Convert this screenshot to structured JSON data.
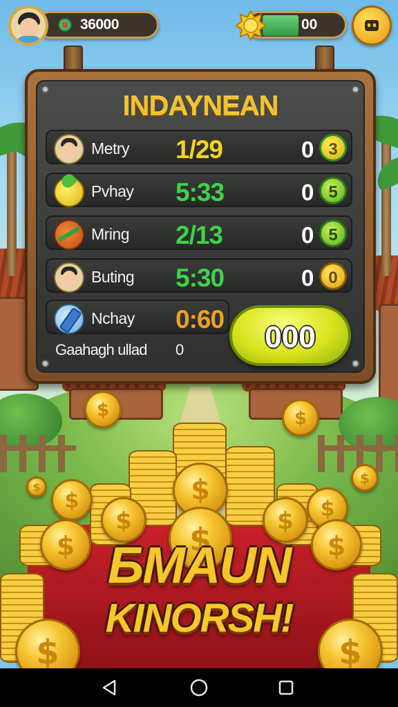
{
  "hud": {
    "cash_value": "36000",
    "energy_value": "00"
  },
  "board": {
    "title": "INDAYNEAN",
    "rows": [
      {
        "name": "Metry",
        "score": "1/29",
        "zero": "0",
        "badge": "3"
      },
      {
        "name": "Pvhay",
        "score": "5:33",
        "zero": "0",
        "badge": "5"
      },
      {
        "name": "Mring",
        "score": "2/13",
        "zero": "0",
        "badge": "5"
      },
      {
        "name": "Buting",
        "score": "5:30",
        "zero": "0",
        "badge": "0"
      },
      {
        "name": "Nchay",
        "score": "0:60"
      }
    ],
    "footer_label": "Gaahagh ullad",
    "footer_value": "0",
    "claim_label": "000"
  },
  "banner": {
    "line1": "БМAUN",
    "line2": "KINORSH!"
  },
  "coin_symbol": "$",
  "colors": {
    "score_yellow": "#f5d21c",
    "score_green": "#3fd24a",
    "score_orange": "#f0a020",
    "gold": "#f7c62b"
  },
  "icons": {
    "nav": [
      "back-icon",
      "home-icon",
      "recents-icon"
    ],
    "hud": [
      "player-avatar",
      "cash-icon",
      "sun-icon",
      "menu-icon"
    ]
  }
}
